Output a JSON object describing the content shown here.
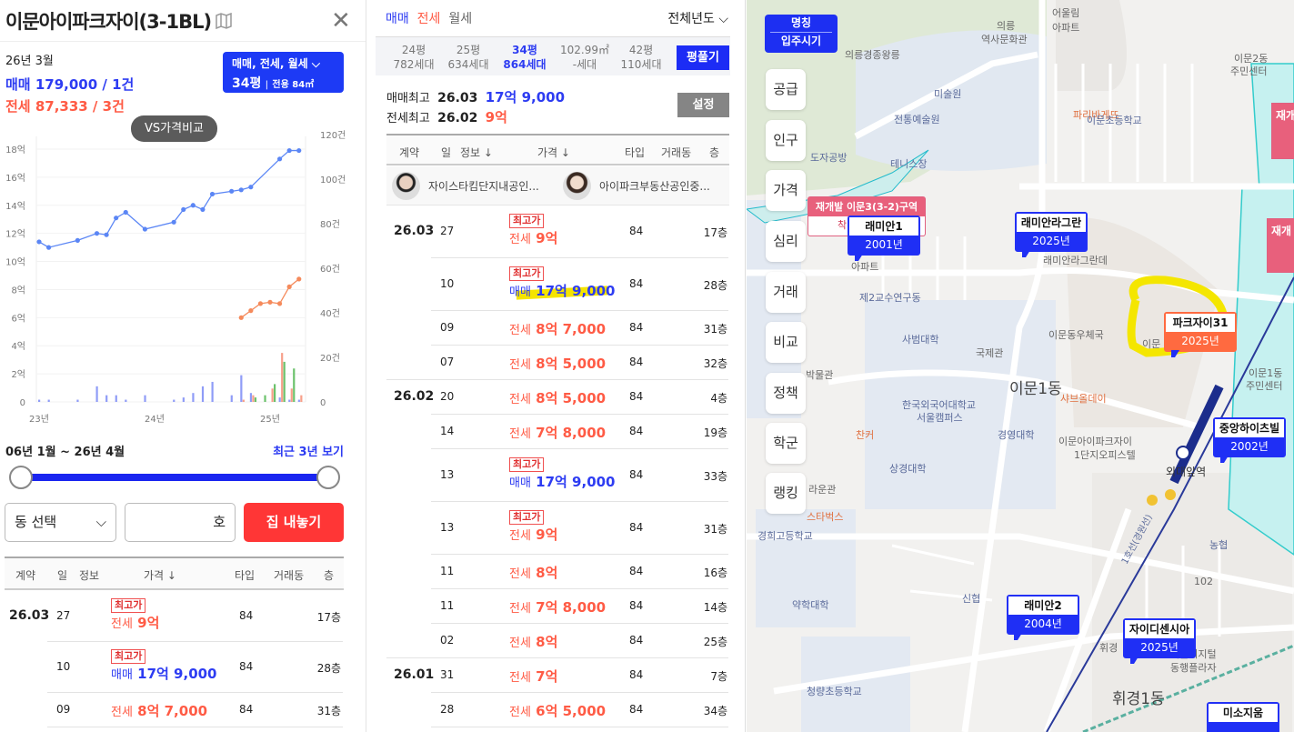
{
  "left": {
    "title": "이문아이파크자이(3-1BL)",
    "date": "26년 3월",
    "sale_summary": "매매 179,000 / 1건",
    "jeonse_summary": "전세 87,333 / 3건",
    "type_select": {
      "line1": "매매, 전세, 월세",
      "size": "34평",
      "area": "전용 84㎡"
    },
    "vs_button": "VS가격비교",
    "range_label": "06년 1월 ~ 26년 4월",
    "recent_link": "최근 3년 보기",
    "slider": {
      "start": 0,
      "end": 1
    },
    "dong_select": "동 선택",
    "ho_suffix": "호",
    "list_button": "집 내놓기",
    "headers": [
      "계약",
      "일",
      "정보",
      "가격 ↓",
      "타입",
      "거래동",
      "층"
    ],
    "rows": [
      {
        "month": "26.03",
        "day": "27",
        "badge": "최고가",
        "kind": "전세",
        "price": "9억",
        "type": "84",
        "floor": "17층",
        "color": "red"
      },
      {
        "month": "",
        "day": "10",
        "badge": "최고가",
        "kind": "매매",
        "price": "17억 9,000",
        "type": "84",
        "floor": "28층",
        "color": "blue"
      },
      {
        "month": "",
        "day": "09",
        "badge": "",
        "kind": "전세",
        "price": "8억 7,000",
        "type": "84",
        "floor": "31층",
        "color": "red"
      }
    ]
  },
  "chart_data": {
    "type": "line",
    "title": "",
    "x_ticks": [
      "23년",
      "24년",
      "25년"
    ],
    "y_left_ticks": [
      "0",
      "2억",
      "4억",
      "6억",
      "8억",
      "10억",
      "12억",
      "14억",
      "16억",
      "18억"
    ],
    "y_right_ticks": [
      "0",
      "20건",
      "40건",
      "60건",
      "80건",
      "100건",
      "120건"
    ],
    "ylim_left": [
      0,
      18
    ],
    "ylim_right": [
      0,
      120
    ],
    "x_unit": "months since 23년 1월",
    "series": [
      {
        "name": "매매",
        "color": "#5b86f5",
        "x": [
          0,
          1,
          4,
          6,
          7,
          8,
          9,
          11,
          14,
          15,
          16,
          17,
          18,
          20,
          21,
          22,
          25,
          26,
          27
        ],
        "values": [
          11.4,
          11.0,
          11.5,
          12.0,
          11.9,
          13.1,
          13.5,
          12.3,
          12.8,
          13.7,
          14.0,
          13.7,
          14.8,
          15.0,
          15.1,
          15.3,
          17.3,
          17.9,
          17.9
        ]
      },
      {
        "name": "전세",
        "color": "#f58a5b",
        "x": [
          21,
          22,
          23,
          24,
          25,
          26,
          27
        ],
        "values": [
          6.0,
          6.5,
          7.0,
          7.1,
          7.0,
          8.2,
          8.75
        ]
      }
    ],
    "volume_series": [
      {
        "name": "매매 건수",
        "color": "#8f9cf7",
        "x": [
          0,
          1,
          4,
          6,
          7,
          8,
          9,
          11,
          14,
          15,
          16,
          17,
          18,
          20,
          21,
          22,
          25,
          26,
          27
        ],
        "values": [
          1,
          1,
          1,
          7,
          3,
          3,
          1,
          3,
          1,
          2,
          4,
          7,
          9,
          3,
          12,
          4,
          2,
          1,
          1
        ]
      },
      {
        "name": "전세 건수",
        "color": "#f7a08a",
        "x": [
          21,
          22,
          24,
          25,
          26,
          27
        ],
        "values": [
          1,
          3,
          6,
          22,
          6,
          3
        ]
      },
      {
        "name": "월세 건수",
        "color": "#6cc26c",
        "x": [
          22,
          23,
          24,
          25,
          26
        ],
        "values": [
          2,
          3,
          8,
          18,
          15
        ]
      }
    ]
  },
  "mid": {
    "tabs": [
      "매매",
      "전세",
      "월세"
    ],
    "year_select": "전체년도",
    "sizes": [
      {
        "p": "24평",
        "h": "782세대"
      },
      {
        "p": "25평",
        "h": "634세대"
      },
      {
        "p": "34평",
        "h": "864세대"
      },
      {
        "p": "102.99㎡",
        "h": "-세대"
      },
      {
        "p": "42평",
        "h": "110세대"
      }
    ],
    "expand_button": "평풀기",
    "max_sale_label": "매매최고",
    "max_sale_date": "26.03",
    "max_sale_price": "17억 9,000",
    "max_jeonse_label": "전세최고",
    "max_jeonse_date": "26.02",
    "max_jeonse_price": "9억",
    "settings_button": "설정",
    "headers": [
      "계약",
      "일",
      "정보 ↓",
      "가격 ↓",
      "타입",
      "거래동",
      "층"
    ],
    "agents": [
      "자이스타킴단지내공인...",
      "아이파크부동산공인중..."
    ],
    "rows": [
      {
        "month": "26.03",
        "day": "27",
        "badge": "최고가",
        "kind": "전세",
        "price": "9억",
        "type": "84",
        "floor": "17층",
        "color": "red"
      },
      {
        "month": "",
        "day": "10",
        "badge": "최고가",
        "kind": "매매",
        "price": "17억 9,000",
        "type": "84",
        "floor": "28층",
        "color": "blue",
        "highlight": true
      },
      {
        "month": "",
        "day": "09",
        "badge": "",
        "kind": "전세",
        "price": "8억 7,000",
        "type": "84",
        "floor": "31층",
        "color": "red"
      },
      {
        "month": "",
        "day": "07",
        "badge": "",
        "kind": "전세",
        "price": "8억 5,000",
        "type": "84",
        "floor": "32층",
        "color": "red"
      },
      {
        "month": "26.02",
        "day": "20",
        "badge": "",
        "kind": "전세",
        "price": "8억 5,000",
        "type": "84",
        "floor": "4층",
        "color": "red"
      },
      {
        "month": "",
        "day": "14",
        "badge": "",
        "kind": "전세",
        "price": "7억 8,000",
        "type": "84",
        "floor": "19층",
        "color": "red"
      },
      {
        "month": "",
        "day": "13",
        "badge": "최고가",
        "kind": "매매",
        "price": "17억 9,000",
        "type": "84",
        "floor": "33층",
        "color": "blue"
      },
      {
        "month": "",
        "day": "13",
        "badge": "최고가",
        "kind": "전세",
        "price": "9억",
        "type": "84",
        "floor": "31층",
        "color": "red"
      },
      {
        "month": "",
        "day": "11",
        "badge": "",
        "kind": "전세",
        "price": "8억",
        "type": "84",
        "floor": "16층",
        "color": "red"
      },
      {
        "month": "",
        "day": "11",
        "badge": "",
        "kind": "전세",
        "price": "7억 8,000",
        "type": "84",
        "floor": "14층",
        "color": "red"
      },
      {
        "month": "",
        "day": "02",
        "badge": "",
        "kind": "전세",
        "price": "8억",
        "type": "84",
        "floor": "25층",
        "color": "red"
      },
      {
        "month": "26.01",
        "day": "31",
        "badge": "",
        "kind": "전세",
        "price": "7억",
        "type": "84",
        "floor": "7층",
        "color": "red"
      },
      {
        "month": "",
        "day": "28",
        "badge": "",
        "kind": "전세",
        "price": "6억 5,000",
        "type": "84",
        "floor": "34층",
        "color": "red"
      }
    ]
  },
  "map": {
    "mode_button": {
      "top": "명칭",
      "bottom": "입주시기"
    },
    "side_menu": [
      "공급",
      "인구",
      "가격",
      "심리",
      "거래",
      "비교",
      "정책",
      "학군",
      "랭킹"
    ],
    "redevelop": {
      "title": "재개발 이문3(3-2)구역",
      "sub": "착",
      "edge1": "재개",
      "edge2": "재개"
    },
    "markers": [
      {
        "name": "래미안1",
        "year": "2001년"
      },
      {
        "name": "래미안라그란",
        "year": "2025년"
      },
      {
        "name": "파크자이31",
        "year": "2025년"
      },
      {
        "name": "중앙하이츠빌",
        "year": "2002년"
      },
      {
        "name": "래미안2",
        "year": "2004년"
      },
      {
        "name": "자이디센시아",
        "year": "2025년"
      },
      {
        "name": "미소지움",
        "year": ""
      }
    ],
    "labels": [
      "의릉경종왕릉",
      "의릉",
      "역사문화관",
      "어울림",
      "아파트",
      "이문2동",
      "주민센터",
      "미술원",
      "전통예술원",
      "파리바게뜨",
      "이문초등학교",
      "도자공방",
      "테니스장",
      "래미안라그란데",
      "아파트",
      "제2교수연구동",
      "이문동우체국",
      "사범대학",
      "국제관",
      "이문1동",
      "박물관",
      "샤브올데이",
      "한국외국어대학교",
      "서울캠퍼스",
      "이문아이파크자이",
      "1단지오피스텔",
      "찬커",
      "경영대학",
      "상경대학",
      "외대앞역",
      "이문1동",
      "주민센터",
      "스타벅스",
      "라운관",
      "경희고등학교",
      "약학대학",
      "신협",
      "농협",
      "102",
      "청량초등학교",
      "휘경",
      "서울디지털",
      "동행플라자",
      "휘경1동",
      "1호선(경원선)",
      "이문"
    ]
  }
}
